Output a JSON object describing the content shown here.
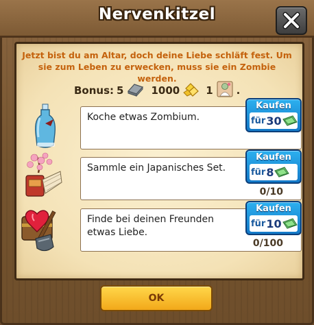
{
  "dialog": {
    "title": "Nervenkitzel",
    "intro": "Jetzt bist du am Altar, doch deine Liebe schläft fest. Um sie zum Leben zu erwecken, muss sie ein Zombie werden.",
    "bonus": {
      "label": "Bonus:",
      "items": [
        {
          "amount": "5",
          "icon": "metal-bar-icon"
        },
        {
          "amount": "1000",
          "icon": "coins-icon"
        },
        {
          "amount": "1",
          "icon": "bride-zombie-card-icon"
        }
      ]
    },
    "tasks": [
      {
        "text": "Koche etwas Zombium.",
        "progress": "",
        "buy_label": "Kaufen",
        "buy_prefix": "für",
        "buy_amount": "30",
        "icon": "zombium-bottle-icon"
      },
      {
        "text": "Sammle ein Japanisches Set.",
        "progress": "0/10",
        "buy_label": "Kaufen",
        "buy_prefix": "für",
        "buy_amount": "8",
        "icon": "japanese-set-icon"
      },
      {
        "text": "Finde bei deinen Freunden etwas Liebe.",
        "progress": "0/100",
        "buy_label": "Kaufen",
        "buy_prefix": "für",
        "buy_amount": "10",
        "icon": "love-chest-icon"
      }
    ],
    "ok_label": "OK"
  },
  "colors": {
    "intro_text": "#c4620d",
    "buy_button": "#1c8ad8",
    "ok_button": "#f5b521",
    "wood": "#7d5a34"
  }
}
